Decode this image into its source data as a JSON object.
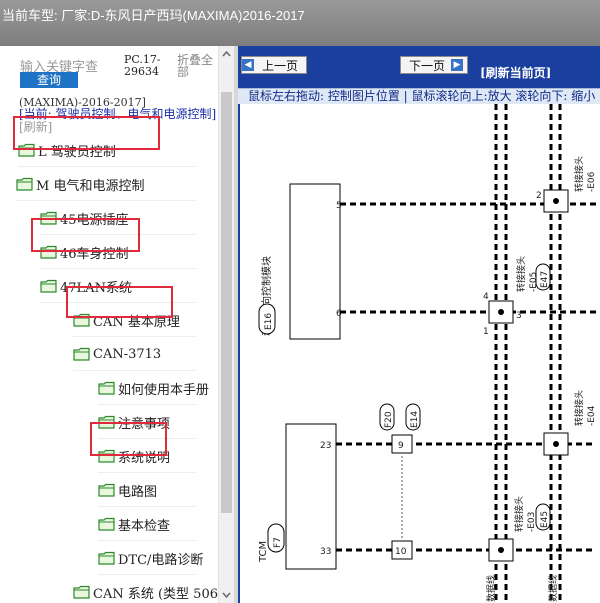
{
  "header": {
    "title": "当前车型:   厂家:D-东风日产西玛(MAXIMA)2016-2017"
  },
  "left_panel": {
    "search_placeholder": "输入关键字查",
    "query_button": "查询",
    "pc_code": "PC.17-29634",
    "collapse_all": "折叠全部",
    "model_line": "(MAXIMA)-2016-2017]",
    "current_prefix": "[当前: 驾驶员控制、电气和电源控制]",
    "refresh_link": "[刷新]",
    "tree": [
      {
        "label": "L 驾驶员控制",
        "highlight": false
      },
      {
        "label": "M 电气和电源控制",
        "highlight": true
      },
      {
        "label": "45电源插座",
        "highlight": false
      },
      {
        "label": "46车身控制",
        "highlight": false
      },
      {
        "label": "47LAN系统",
        "highlight": true
      },
      {
        "label": "CAN 基本原理",
        "highlight": false
      },
      {
        "label": "CAN-3713",
        "highlight": true
      },
      {
        "label": "如何使用本手册",
        "highlight": false
      },
      {
        "label": "注意事项",
        "highlight": false
      },
      {
        "label": "系统说明",
        "highlight": false
      },
      {
        "label": "电路图",
        "highlight": true
      },
      {
        "label": "基本检查",
        "highlight": false
      },
      {
        "label": "DTC/电路诊断",
        "highlight": false
      },
      {
        "label": "CAN 系统 (类型 506)",
        "highlight": false
      }
    ]
  },
  "right_panel": {
    "prev_button": "上一页",
    "next_button": "下一页",
    "refresh_current": "[刷新当前页]",
    "hint": "鼠标左右拖动: 控制图片位置 | 鼠标滚轮向上:放大  滚轮向下: 缩小"
  },
  "diagram": {
    "module_top_label": "动力转向控制模块",
    "module_top_code": "E16",
    "module_top_pins": [
      "5",
      "6"
    ],
    "tcm_label": "TCM",
    "tcm_code": "F7",
    "tcm_pins": [
      "23",
      "33"
    ],
    "connector_top_right_label": "转接接头",
    "connector_top_right_code": "-E06",
    "connector_mid_label": "转接接头",
    "connector_mid_code": "-E05",
    "connector_mid_box": "E47",
    "connector_right2_label": "转接接头",
    "connector_right2_code": "-E04",
    "connector_low_label": "转接接头",
    "connector_low_code": "-E03",
    "connector_low_box": "E45",
    "inline_codes": [
      "F20",
      "E14"
    ],
    "inline_pins": [
      "9",
      "10"
    ],
    "junction_pins": [
      "2",
      "4",
      "1",
      "3"
    ],
    "bottom_labels": [
      "数据线",
      "数据线"
    ]
  },
  "colors": {
    "titlebar": "#8a8a8a",
    "right_bg": "#1b3f9e",
    "highlight": "#e0293b",
    "query_button": "#1f73c5"
  }
}
